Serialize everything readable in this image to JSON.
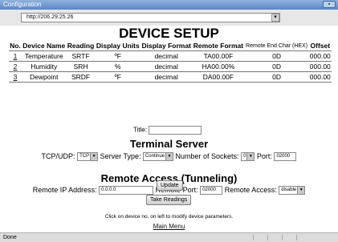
{
  "window": {
    "title": "Configuration",
    "url": "http://206.29.25.26"
  },
  "heading": "DEVICE SETUP",
  "table": {
    "headers": {
      "no": "No.",
      "name": "Device Name",
      "reading": "Reading",
      "units": "Display Units",
      "format": "Display Format",
      "remote": "Remote Format",
      "endchar": "Remote End Char (HEX)",
      "offset": "Offset"
    },
    "rows": [
      {
        "no": "1",
        "name": "Temperature",
        "reading": "SRTF",
        "units": "ºF",
        "format": "decimal",
        "remote": "TA00.00F",
        "endchar": "0D",
        "offset": "000.00"
      },
      {
        "no": "2",
        "name": "Humidity",
        "reading": "SRH",
        "units": "%",
        "format": "decimal",
        "remote": "HA00.00%",
        "endchar": "0D",
        "offset": "000.00"
      },
      {
        "no": "3",
        "name": "Dewpoint",
        "reading": "SRDF",
        "units": "ºF",
        "format": "decimal",
        "remote": "DA00.00F",
        "endchar": "0D",
        "offset": "000.00"
      }
    ]
  },
  "title_label": "Title:",
  "terminal": {
    "heading": "Terminal Server",
    "tcpudp_label": "TCP/UDP:",
    "tcpudp_value": "TCP",
    "type_label": "Server Type:",
    "type_value": "Continue",
    "sockets_label": "Number of Sockets:",
    "sockets_value": "0",
    "port_label": "Port:",
    "port_value": "02000"
  },
  "remote": {
    "heading": "Remote Access (Tunneling)",
    "ip_label": "Remote IP Address:",
    "ip_value": "0.0.0.0",
    "port_label": "Remote Port:",
    "port_value": "02000",
    "access_label": "Remote Access:",
    "access_value": "disable"
  },
  "buttons": {
    "update": "Update",
    "take_readings": "Take Readings"
  },
  "note": "Click on device no. on left to modify device parameters.",
  "main_menu": "Main Menu",
  "status": "Done"
}
